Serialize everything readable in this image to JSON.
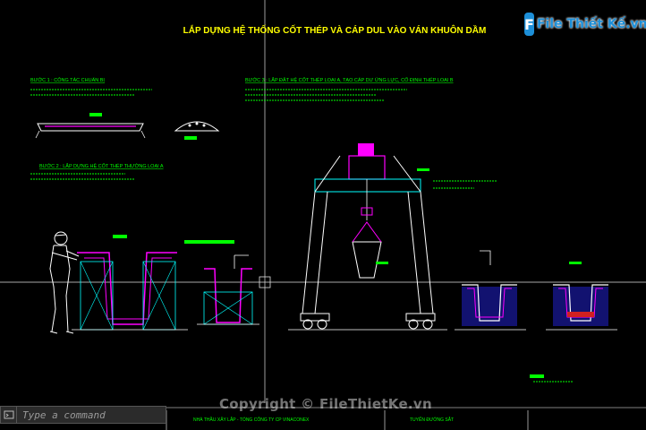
{
  "drawing": {
    "main_title": "LẮP DỰNG HỆ THỐNG CỐT THÉP VÀ CÁP DUL VÀO VÁN KHUÔN DẦM",
    "step1_heading": "BƯỚC 1 : CÔNG TÁC CHUẨN BỊ",
    "step2_heading": "BƯỚC 2 : LẮP DỰNG HỆ CỐT THÉP THƯỜNG LOẠI A",
    "step3_heading": "BƯỚC 3 : LẮP ĐẶT HỆ CỐT THÉP LOẠI A, TẠO CÁP DƯ ỨNG LỰC, CỐ ĐỊNH THÉP LOẠI B",
    "footer_left": "NHÀ THẦU XÂY LẮP - TỔNG CÔNG TY CP VINACONEX",
    "footer_mid": "TUYẾN ĐƯỜNG SẮT"
  },
  "logo": {
    "mark": "F",
    "text": "File Thiết Kế.vn"
  },
  "watermark": "Copyright © FileThietKe.vn",
  "command_line": {
    "placeholder": "Type a command"
  },
  "colors": {
    "background": "#000000",
    "title": "#ffff00",
    "heading": "#00ff00",
    "structure": "#ff00ff",
    "frame": "#00ffff",
    "note": "#00ff00",
    "brand": "#1d8fd8"
  }
}
